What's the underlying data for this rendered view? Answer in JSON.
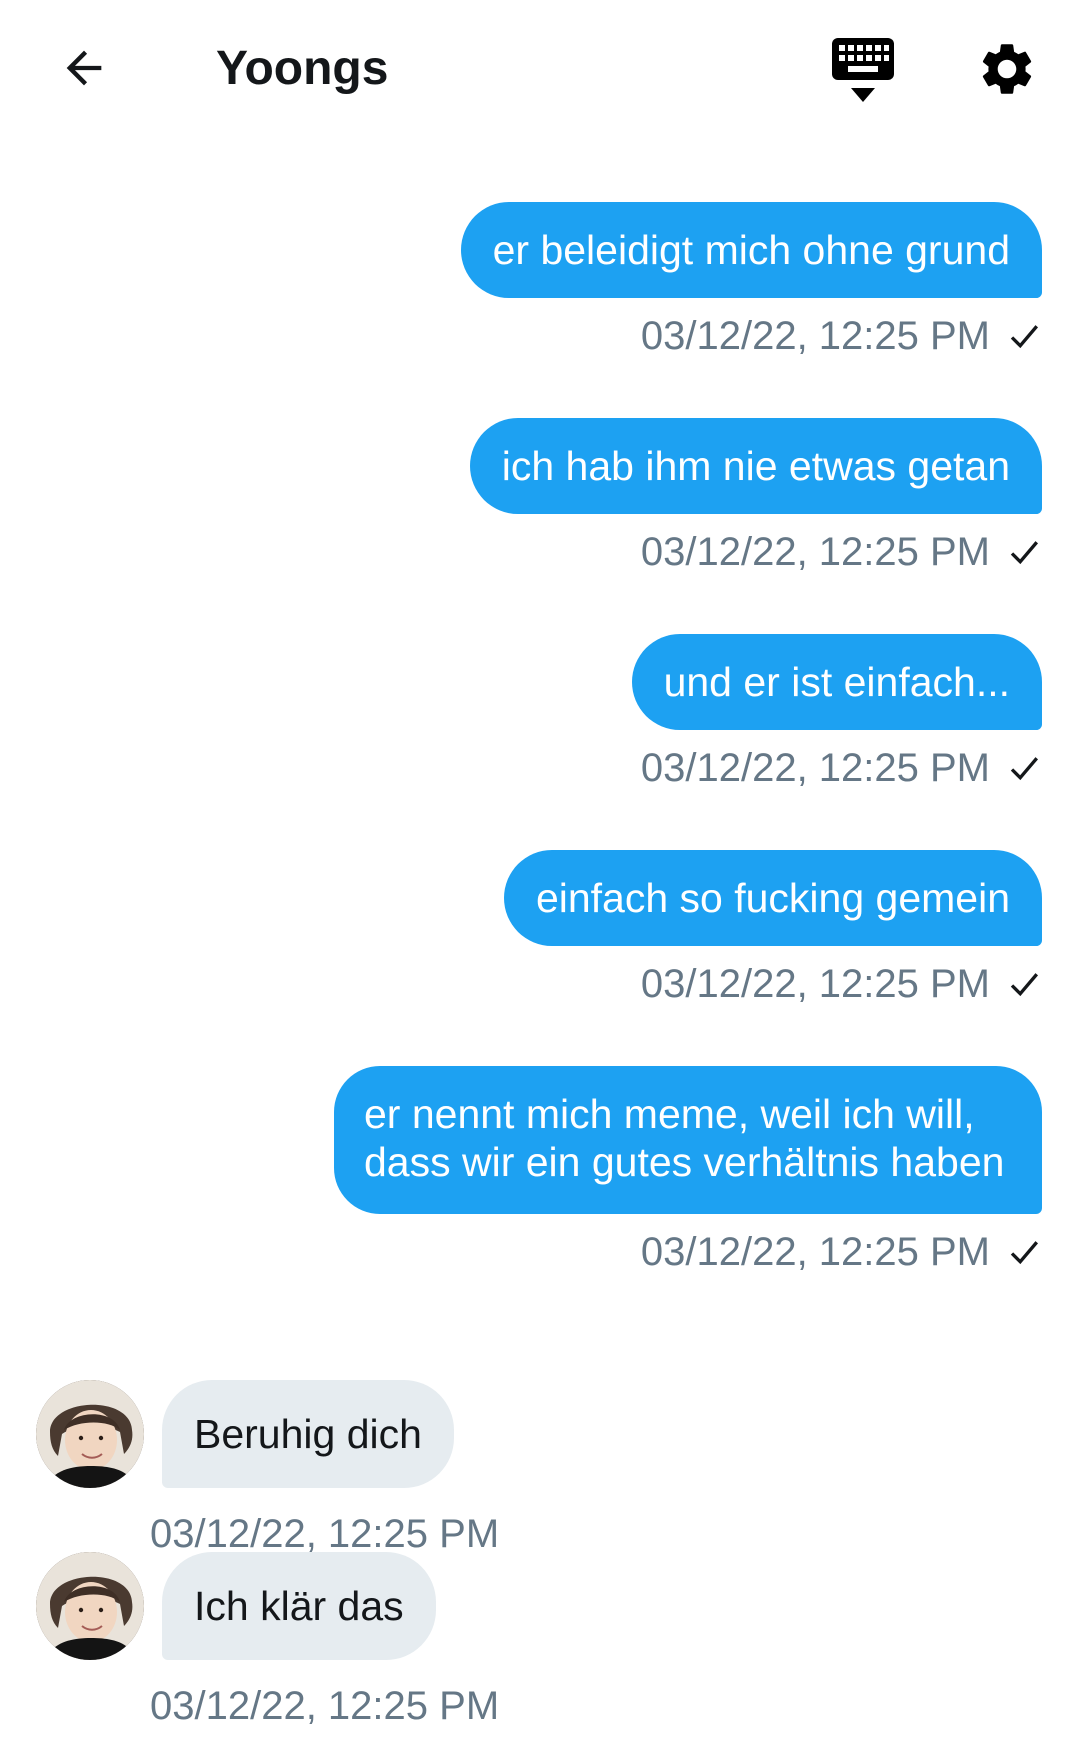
{
  "header": {
    "title": "Yoongs",
    "back_icon": "arrow-left-icon",
    "keyboard_icon": "keyboard-hide-icon",
    "settings_icon": "gear-icon"
  },
  "colors": {
    "outgoing_bubble": "#1da1f2",
    "incoming_bubble": "#e6ecf0",
    "timestamp": "#657786"
  },
  "messages": [
    {
      "direction": "out",
      "text": "er beleidigt mich ohne grund",
      "time": "03/12/22, 12:25 PM",
      "status": "check-icon"
    },
    {
      "direction": "out",
      "text": "ich hab ihm nie etwas getan",
      "time": "03/12/22, 12:25 PM",
      "status": "check-icon"
    },
    {
      "direction": "out",
      "text": "und er ist einfach...",
      "time": "03/12/22, 12:25 PM",
      "status": "check-icon"
    },
    {
      "direction": "out",
      "text": "einfach so fucking gemein",
      "time": "03/12/22, 12:25 PM",
      "status": "check-icon"
    },
    {
      "direction": "out",
      "text": "er nennt mich meme, weil ich will, dass wir ein gutes verhältnis haben",
      "time": "03/12/22, 12:25 PM",
      "status": "check-icon"
    },
    {
      "direction": "in",
      "text": "Beruhig dich",
      "time": "03/12/22, 12:25 PM",
      "avatar": "avatar"
    },
    {
      "direction": "in",
      "text": "Ich klär das",
      "time": "03/12/22, 12:25 PM",
      "avatar": "avatar"
    }
  ]
}
